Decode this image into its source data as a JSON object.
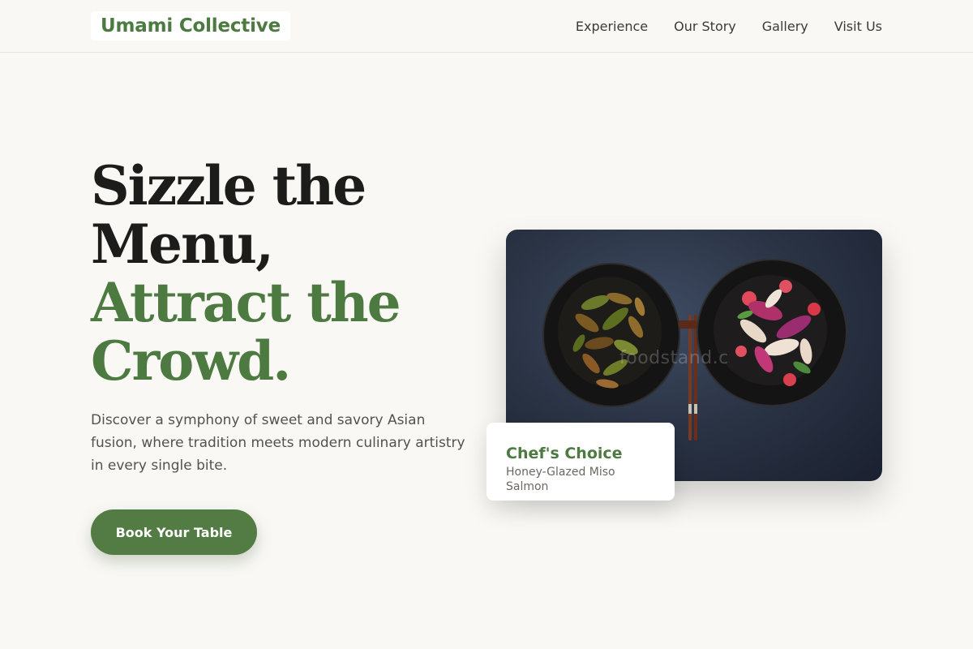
{
  "header": {
    "logo": "Umami Collective",
    "nav": [
      "Experience",
      "Our Story",
      "Gallery",
      "Visit Us"
    ]
  },
  "hero": {
    "headline_dark": [
      "Sizzle the",
      "Menu,"
    ],
    "headline_green": [
      "Attract the",
      "Crowd."
    ],
    "subtext": "Discover a symphony of sweet and savory Asian fusion, where tradition meets modern culinary artistry in every single bite.",
    "cta_label": "Book Your Table"
  },
  "image": {
    "watermark": "foodstand.c"
  },
  "chef_card": {
    "title": "Chef's Choice",
    "dish": "Honey-Glazed Miso Salmon"
  },
  "colors": {
    "background": "#f9f8f5",
    "accent_green": "#4c7a40",
    "button_green": "#527c44",
    "headline_dark": "#1c1c1a"
  }
}
